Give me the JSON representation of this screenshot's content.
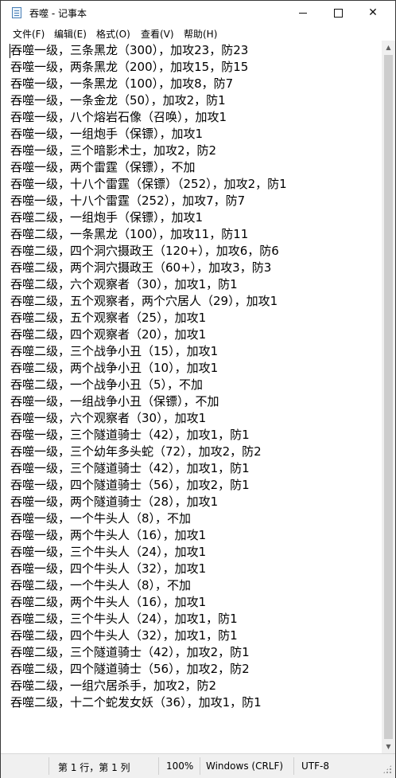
{
  "window": {
    "title": "吞噬 - 记事本"
  },
  "menu": [
    "文件(F)",
    "编辑(E)",
    "格式(O)",
    "查看(V)",
    "帮助(H)"
  ],
  "lines": [
    "吞噬一级，三条黑龙（300），加攻23，防23",
    "吞噬一级，两条黑龙（200），加攻15，防15",
    "吞噬一级，一条黑龙（100），加攻8，防7",
    "吞噬一级，一条金龙（50），加攻2，防1",
    "吞噬一级，八个熔岩石像（召唤），加攻1",
    "吞噬一级，一组炮手（保镖），加攻1",
    "吞噬一级，三个暗影术士，加攻2，防2",
    "吞噬一级，两个雷霆（保镖），不加",
    "吞噬一级，十八个雷霆（保镖）（252），加攻2，防1",
    "吞噬一级，十八个雷霆（252），加攻7，防7",
    "吞噬二级，一组炮手（保镖），加攻1",
    "吞噬二级，一条黑龙（100），加攻11，防11",
    "吞噬二级，四个洞穴摄政王（120+），加攻6，防6",
    "吞噬二级，两个洞穴摄政王（60+），加攻3，防3",
    "吞噬二级，六个观察者（30），加攻1，防1",
    "吞噬二级，五个观察者，两个穴居人（29），加攻1",
    "吞噬二级，五个观察者（25），加攻1",
    "吞噬二级，四个观察者（20），加攻1",
    "吞噬二级，三个战争小丑（15），加攻1",
    "吞噬二级，两个战争小丑（10），加攻1",
    "吞噬二级，一个战争小丑（5），不加",
    "吞噬一级，一组战争小丑（保镖），不加",
    "吞噬一级，六个观察者（30），加攻1",
    "吞噬一级，三个隧道骑士（42），加攻1，防1",
    "吞噬一级，三个幼年多头蛇（72），加攻2，防2",
    "吞噬一级，三个隧道骑士（42），加攻1，防1",
    "吞噬一级，四个隧道骑士（56），加攻2，防1",
    "吞噬一级，两个隧道骑士（28），加攻1",
    "吞噬一级，一个牛头人（8），不加",
    "吞噬一级，两个牛头人（16），加攻1",
    "吞噬一级，三个牛头人（24），加攻1",
    "吞噬一级，四个牛头人（32），加攻1",
    "吞噬二级，一个牛头人（8），不加",
    "吞噬二级，两个牛头人（16），加攻1",
    "吞噬二级，三个牛头人（24），加攻1，防1",
    "吞噬二级，四个牛头人（32），加攻1，防1",
    "吞噬二级，三个隧道骑士（42），加攻2，防1",
    "吞噬二级，四个隧道骑士（56），加攻2，防2",
    "吞噬二级，一组穴居杀手，加攻2，防2",
    "吞噬二级，十二个蛇发女妖（36），加攻1，防1"
  ],
  "status": {
    "position": "第 1 行，第 1 列",
    "zoom": "100%",
    "line_ending": "Windows (CRLF)",
    "encoding": "UTF-8"
  }
}
